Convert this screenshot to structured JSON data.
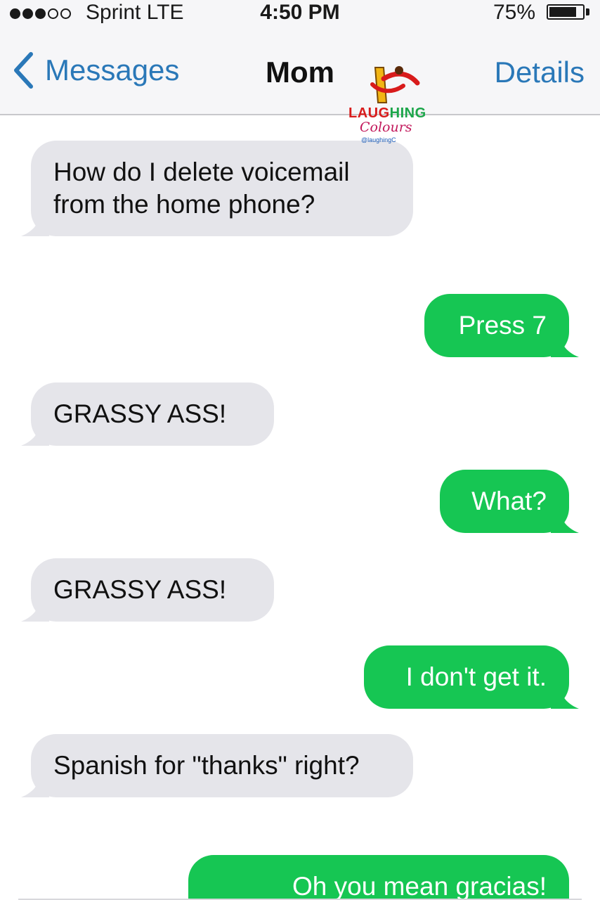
{
  "status_bar": {
    "carrier": "Sprint  LTE",
    "time": "4:50 PM",
    "battery": "75%",
    "battery_level": 0.75,
    "signal_bars_filled": 3,
    "signal_bars_total": 5
  },
  "nav": {
    "back_label": "Messages",
    "title": "Mom",
    "details_label": "Details"
  },
  "watermark": {
    "line1_a": "LAUG",
    "line1_b": "HING",
    "line2": "Colours",
    "line3": "@laughingC"
  },
  "colors": {
    "accent": "#2a78b8",
    "incoming_bubble": "#e5e5ea",
    "outgoing_bubble": "#16c653"
  },
  "messages": [
    {
      "direction": "incoming",
      "text": "How do I delete voicemail from the home phone?"
    },
    {
      "direction": "outgoing",
      "text": "Press 7"
    },
    {
      "direction": "incoming",
      "text": "GRASSY ASS!"
    },
    {
      "direction": "outgoing",
      "text": "What?"
    },
    {
      "direction": "incoming",
      "text": "GRASSY ASS!"
    },
    {
      "direction": "outgoing",
      "text": "I don't get it."
    },
    {
      "direction": "incoming",
      "text": "Spanish for \"thanks\" right?"
    },
    {
      "direction": "outgoing",
      "text": "Oh you mean gracias!"
    }
  ]
}
